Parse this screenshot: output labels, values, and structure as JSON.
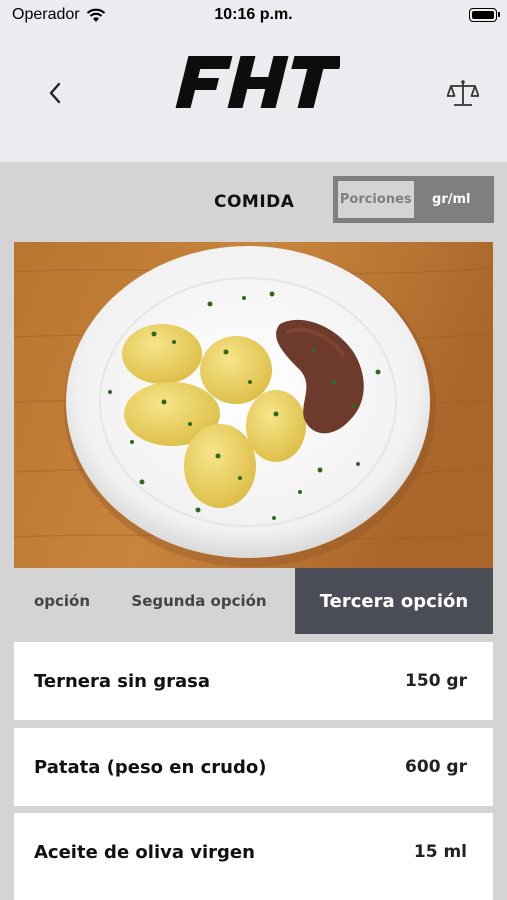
{
  "status_bar": {
    "carrier": "Operador",
    "time": "10:16 p.m."
  },
  "nav": {
    "logo_text": "FHT",
    "back_icon": "chevron-left-icon",
    "scale_icon": "balance-scale-icon"
  },
  "section": {
    "title": "COMIDA"
  },
  "unit_toggle": {
    "options": [
      "Porciones",
      "gr/ml"
    ],
    "selected": "gr/ml"
  },
  "photo": {
    "description_icon": "plate-image"
  },
  "option_tabs": [
    {
      "label": "opción"
    },
    {
      "label": "Segunda opción"
    },
    {
      "label": "Tercera opción",
      "selected": true
    }
  ],
  "ingredients": [
    {
      "name": "Ternera sin grasa",
      "amount": "150 gr"
    },
    {
      "name": "Patata (peso en crudo)",
      "amount": "600 gr"
    },
    {
      "name": "Aceite de oliva virgen",
      "amount": "15 ml"
    }
  ],
  "colors": {
    "accent_tab": "#4b4e57",
    "toggle_active": "#7f7f7f",
    "background": "#d4d4d4"
  }
}
